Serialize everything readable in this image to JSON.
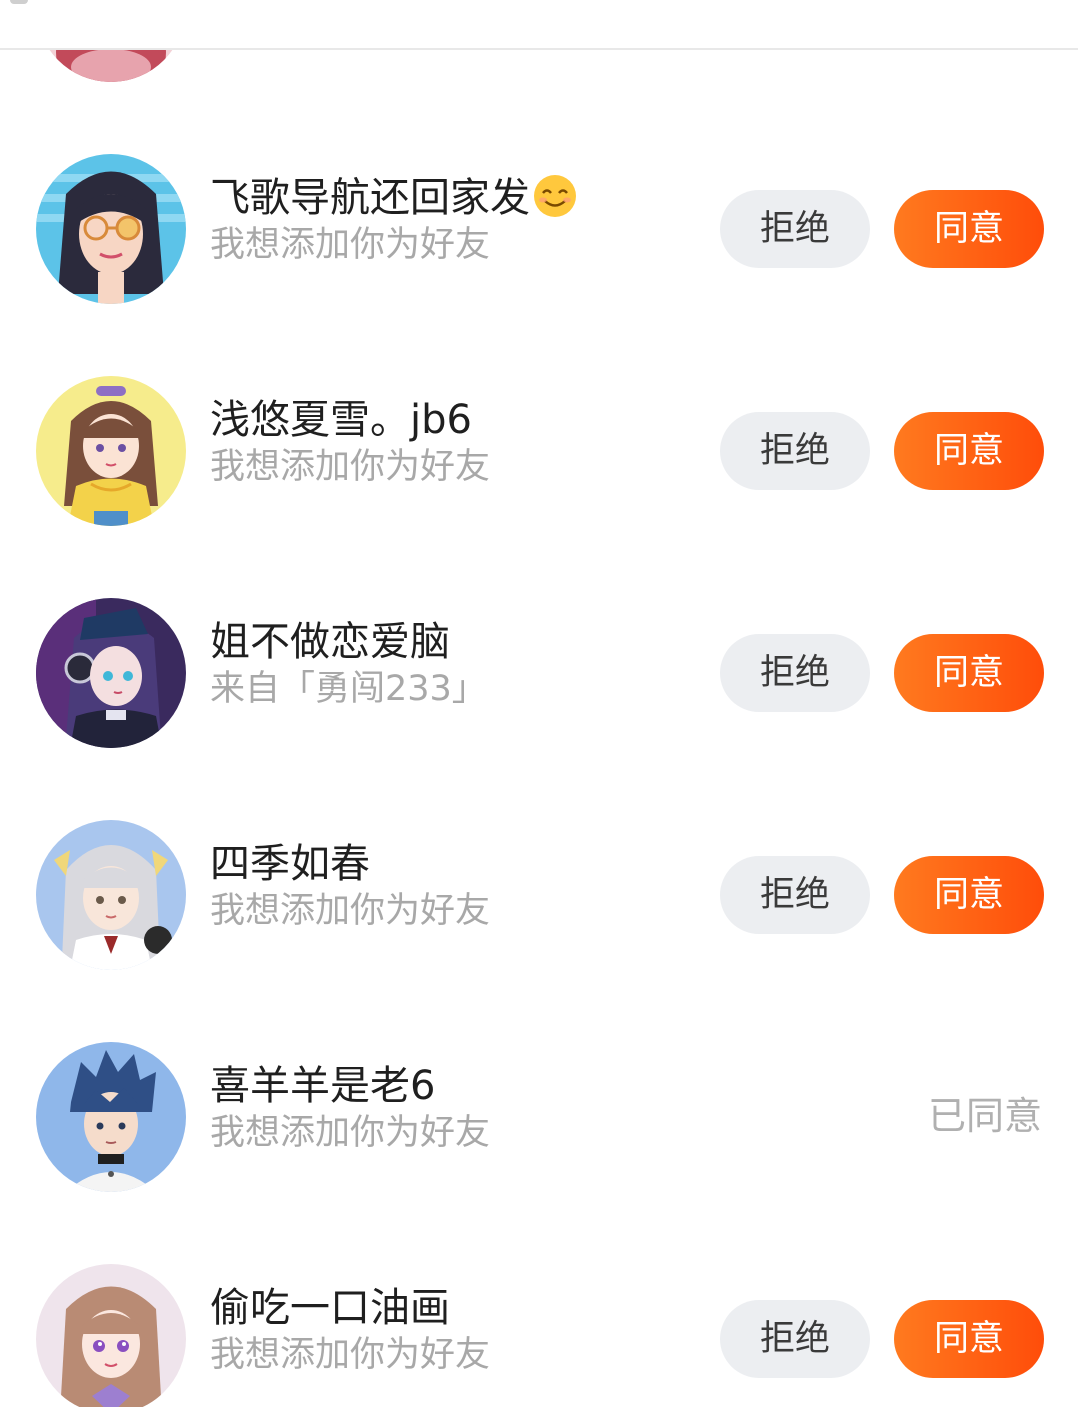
{
  "requests": [
    {
      "name": "飞歌导航还回家发",
      "emoji_icon": "smiling-face-emoji",
      "subtitle": "我想添加你为好友",
      "reject_label": "拒绝",
      "accept_label": "同意",
      "avatar_icon": "avatar-girl-sunglasses",
      "colors": {
        "bg": "#5cc3e8",
        "hair": "#2b2a3c",
        "skin": "#f7d6c4"
      }
    },
    {
      "name": "浅悠夏雪。jb6",
      "subtitle": "我想添加你为好友",
      "reject_label": "拒绝",
      "accept_label": "同意",
      "avatar_icon": "avatar-girl-yellow",
      "colors": {
        "bg": "#f6ec8c",
        "hair": "#7a4f3b",
        "skin": "#fbe3d4"
      }
    },
    {
      "name": "姐不做恋爱脑",
      "subtitle": "来自「勇闯233」",
      "reject_label": "拒绝",
      "accept_label": "同意",
      "avatar_icon": "avatar-girl-headphones",
      "colors": {
        "bg": "#3a2a5e",
        "hair": "#4a3b7a",
        "skin": "#f4dfe0"
      }
    },
    {
      "name": "四季如春",
      "subtitle": "我想添加你为好友",
      "reject_label": "拒绝",
      "accept_label": "同意",
      "avatar_icon": "avatar-girl-silver-hair",
      "colors": {
        "bg": "#a9c6ee",
        "hair": "#d9d9de",
        "skin": "#f8e6da"
      }
    },
    {
      "name": "喜羊羊是老6",
      "subtitle": "我想添加你为好友",
      "accepted_label": "已同意",
      "avatar_icon": "avatar-boy-blue-hair",
      "colors": {
        "bg": "#8fb7ea",
        "hair": "#2f4f86",
        "skin": "#f5dccb"
      }
    },
    {
      "name": "偷吃一口油画",
      "subtitle": "我想添加你为好友",
      "reject_label": "拒绝",
      "accept_label": "同意",
      "avatar_icon": "avatar-girl-pink",
      "colors": {
        "bg": "#efe4ec",
        "hair": "#b98b74",
        "skin": "#fbe7df"
      }
    }
  ],
  "theme": {
    "accept_gradient_start": "#ff7a1f",
    "accept_gradient_end": "#ff4d0a",
    "reject_bg": "#eceef1",
    "subtitle_color": "#a8a8a8"
  }
}
